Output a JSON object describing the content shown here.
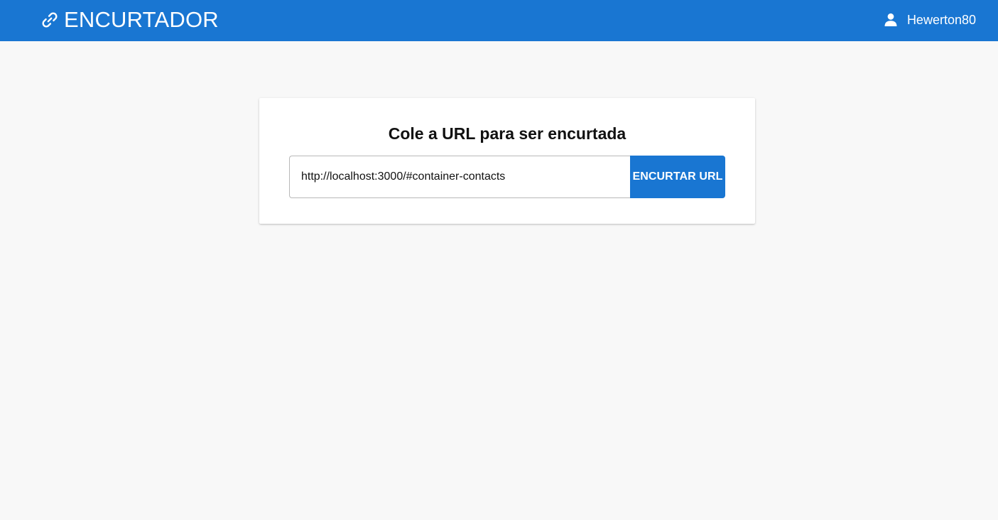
{
  "header": {
    "brand_icon": "link-icon",
    "brand": "ENCURTADOR",
    "user_icon": "user-icon",
    "username": "Hewerton80"
  },
  "main": {
    "title": "Cole a URL para ser encurtada",
    "url_input": {
      "value": "http://localhost:3000/#container-contacts",
      "placeholder": ""
    },
    "submit_label": "ENCURTAR URL"
  },
  "colors": {
    "primary": "#1976d2",
    "background": "#f8f8f8",
    "card": "#ffffff"
  }
}
